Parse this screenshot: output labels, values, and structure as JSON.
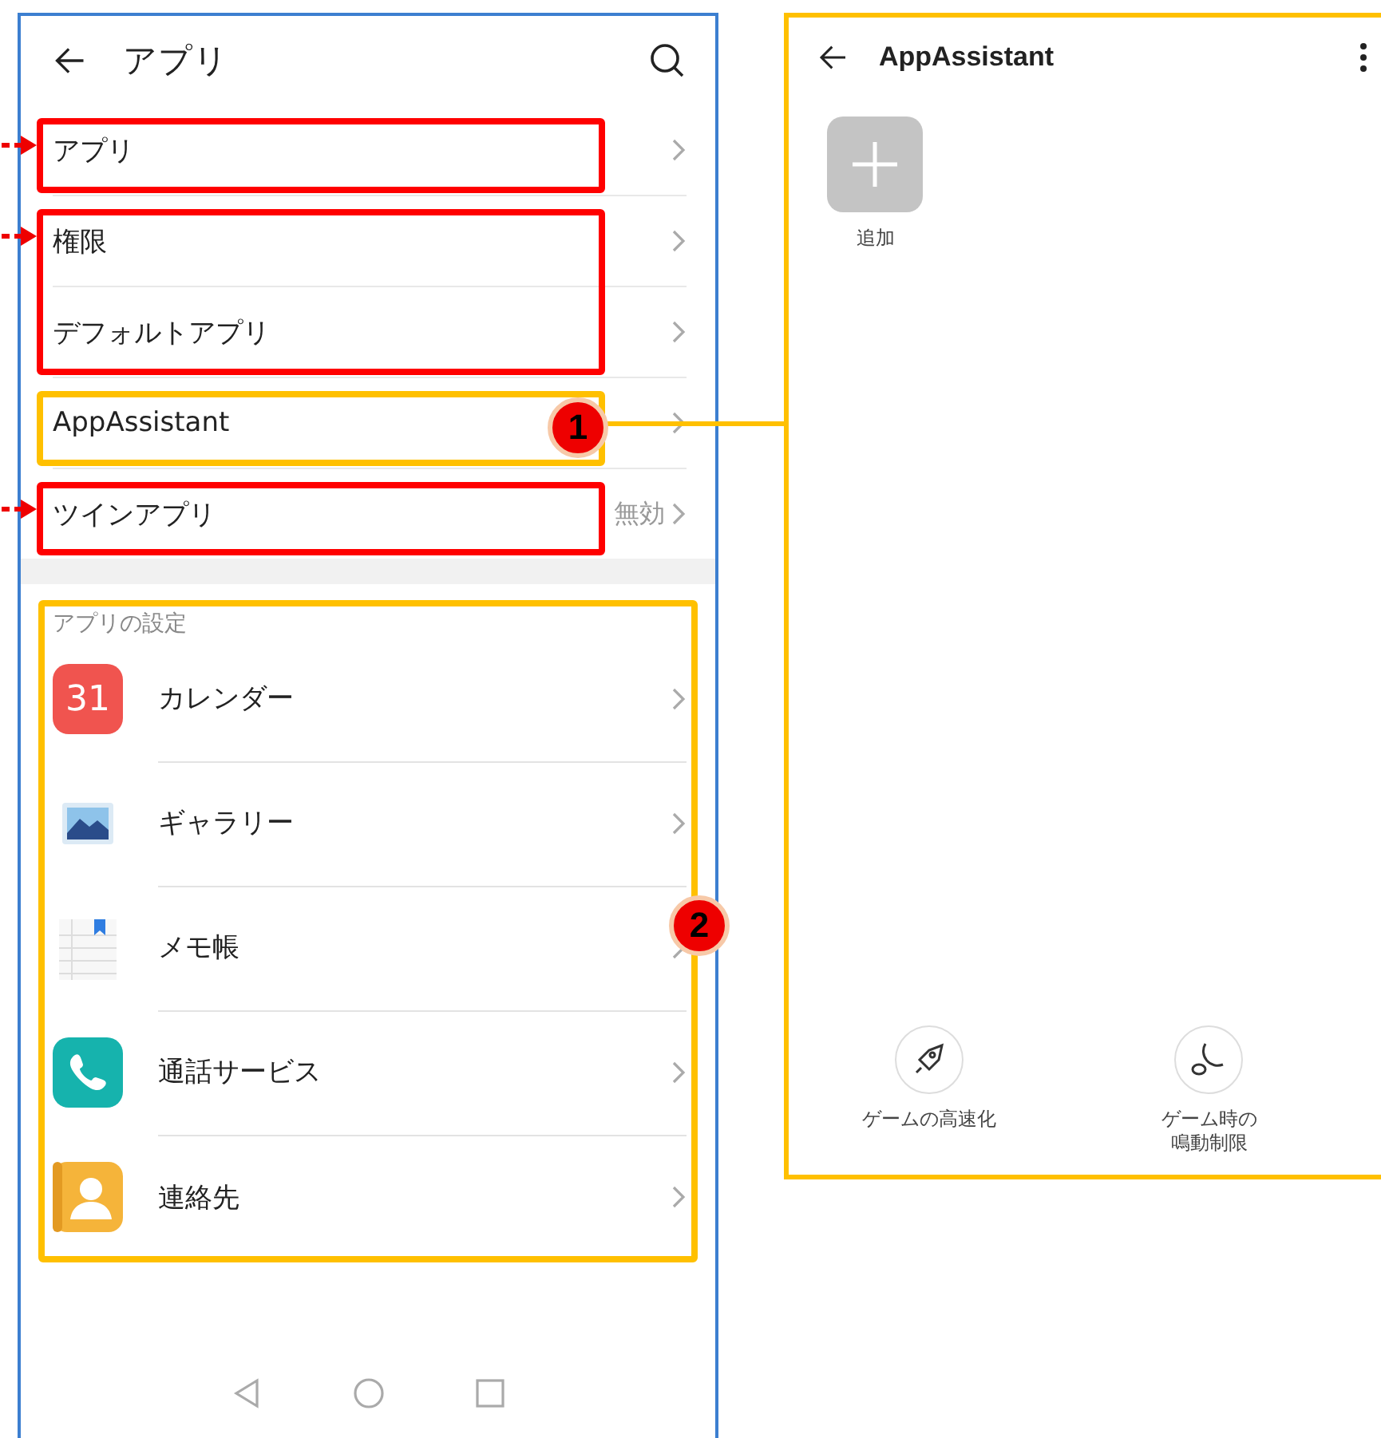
{
  "left_screen": {
    "title": "アプリ",
    "menu_groups": [
      {
        "color": "#ff0000",
        "pointer": true,
        "items": [
          {
            "label": "アプリ"
          }
        ]
      },
      {
        "color": "#ff0000",
        "pointer": true,
        "items": [
          {
            "label": "権限"
          },
          {
            "label": "デフォルトアプリ"
          }
        ]
      },
      {
        "color": "#ffc000",
        "pointer": false,
        "badge": "1",
        "items": [
          {
            "label": "AppAssistant"
          }
        ]
      },
      {
        "color": "#ff0000",
        "pointer": true,
        "items": [
          {
            "label": "ツインアプリ",
            "value": "無効"
          }
        ]
      }
    ],
    "settings_section": {
      "color": "#ffc000",
      "badge": "2",
      "title": "アプリの設定",
      "apps": [
        {
          "kind": "calendar",
          "icon_text": "31",
          "label": "カレンダー"
        },
        {
          "kind": "gallery",
          "label": "ギャラリー"
        },
        {
          "kind": "notepad",
          "label": "メモ帳"
        },
        {
          "kind": "phone",
          "label": "通話サービス"
        },
        {
          "kind": "contacts",
          "label": "連絡先"
        }
      ]
    }
  },
  "right_screen": {
    "color": "#ffc000",
    "title": "AppAssistant",
    "add_tile": {
      "label": "追加"
    },
    "actions": [
      {
        "kind": "rocket",
        "lines": [
          "ゲームの高速化"
        ]
      },
      {
        "kind": "moon",
        "lines": [
          "ゲーム時の",
          "鳴動制限"
        ]
      }
    ]
  }
}
